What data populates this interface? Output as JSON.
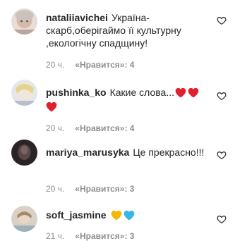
{
  "comments": [
    {
      "username": "nataliiavichei",
      "text": "Україна-скарб,оберігаймо її культурну ,екологічну спадщину!",
      "time": "20 ч.",
      "likes": "«Нравится»: 4",
      "avatar_color": "#d9c7c0"
    },
    {
      "username": "pushinka_ko",
      "text": "Какие слова...",
      "emojis": [
        "red-heart",
        "red-heart",
        "red-heart"
      ],
      "time": "20 ч.",
      "likes": "«Нравится»: 4",
      "avatar_color": "#cfd3d8"
    },
    {
      "username": "mariya_marusyka",
      "text": "Це прекрасно!!!",
      "time": "20 ч.",
      "likes": "«Нравится»: 3",
      "avatar_color": "#3a3030"
    },
    {
      "username": "soft_jasmine",
      "text": "",
      "emojis": [
        "yellow-heart",
        "blue-heart"
      ],
      "time": "21 ч.",
      "likes": "«Нравится»: 3",
      "avatar_color": "#c8c0b0"
    }
  ],
  "colors": {
    "red_heart": "#e0202e",
    "yellow_heart": "#f5b800",
    "blue_heart": "#37b6e8",
    "meta_text": "#8e8e8e"
  }
}
